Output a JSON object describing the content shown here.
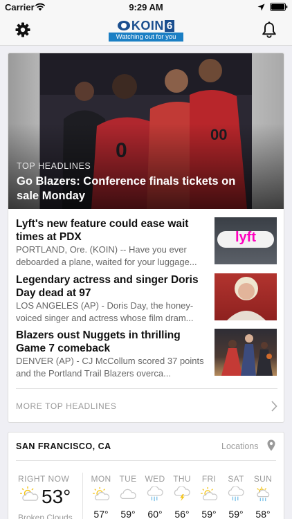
{
  "status_bar": {
    "carrier": "Carrier",
    "time": "9:29 AM"
  },
  "header": {
    "logo": {
      "word": "KOIN",
      "number": "6",
      "tagline": "Watching out for you"
    }
  },
  "top_story": {
    "kicker": "TOP HEADLINES",
    "headline": "Go Blazers: Conference finals tickets on sale Monday"
  },
  "stories": [
    {
      "title": "Lyft's new feature could ease wait times at PDX",
      "summary": "PORTLAND, Ore. (KOIN) -- Have you ever deboarded a plane, waited for your luggage...",
      "thumb_text": "lyft"
    },
    {
      "title": "Legendary actress and singer Doris Day dead at 97",
      "summary": "LOS ANGELES (AP) - Doris Day, the honey-voiced singer and actress whose film dram..."
    },
    {
      "title": "Blazers oust Nuggets in thrilling Game 7 comeback",
      "summary": "DENVER (AP) - CJ McCollum scored 37 points and the Portland Trail Blazers overca..."
    }
  ],
  "more_link": "MORE TOP HEADLINES",
  "weather": {
    "city": "SAN FRANCISCO, CA",
    "locations_label": "Locations",
    "now": {
      "label": "RIGHT NOW",
      "temp": "53°",
      "condition": "Broken Clouds",
      "icon": "partly-sunny-icon"
    },
    "forecast": [
      {
        "day": "MON",
        "temp": "57°",
        "icon": "partly-sunny-icon"
      },
      {
        "day": "TUE",
        "temp": "59°",
        "icon": "cloud-icon"
      },
      {
        "day": "WED",
        "temp": "60°",
        "icon": "rain-icon"
      },
      {
        "day": "THU",
        "temp": "56°",
        "icon": "thunderstorm-icon"
      },
      {
        "day": "FRI",
        "temp": "59°",
        "icon": "partly-sunny-icon"
      },
      {
        "day": "SAT",
        "temp": "59°",
        "icon": "rain-icon"
      },
      {
        "day": "SUN",
        "temp": "58°",
        "icon": "sun-rain-icon"
      }
    ]
  },
  "colors": {
    "brand": "#1b4f8f",
    "brand_light": "#1b7fc4",
    "lyft_pink": "#ff00bf",
    "icon_sun": "#f5c518",
    "icon_rain": "#7fc3e8",
    "icon_cloud": "#c8c8c8"
  }
}
